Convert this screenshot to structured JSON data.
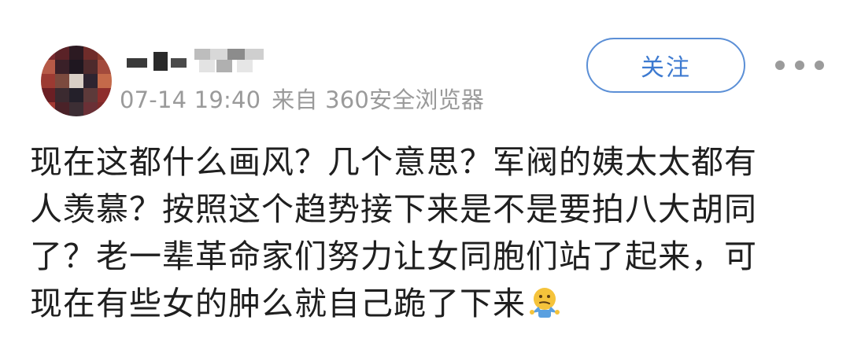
{
  "post": {
    "meta": {
      "date": "07-14 19:40",
      "source": "来自 360安全浏览器"
    },
    "follow_label": "关注",
    "content_lines": [
      "现在这都什么画风？几个意思？军阀的姨太太都有",
      "人羡慕？按照这个趋势接下来是不是要拍八大胡同",
      "了？老一辈革命家们努力让女同胞们站了起来，可",
      "现在有些女的肿么就自己跪了下来"
    ],
    "emoji_name": "shrug-emoji",
    "colors": {
      "accent": "#3d7ad0",
      "meta_text": "#9a9a9a",
      "body_text": "#1f1f1f"
    }
  }
}
